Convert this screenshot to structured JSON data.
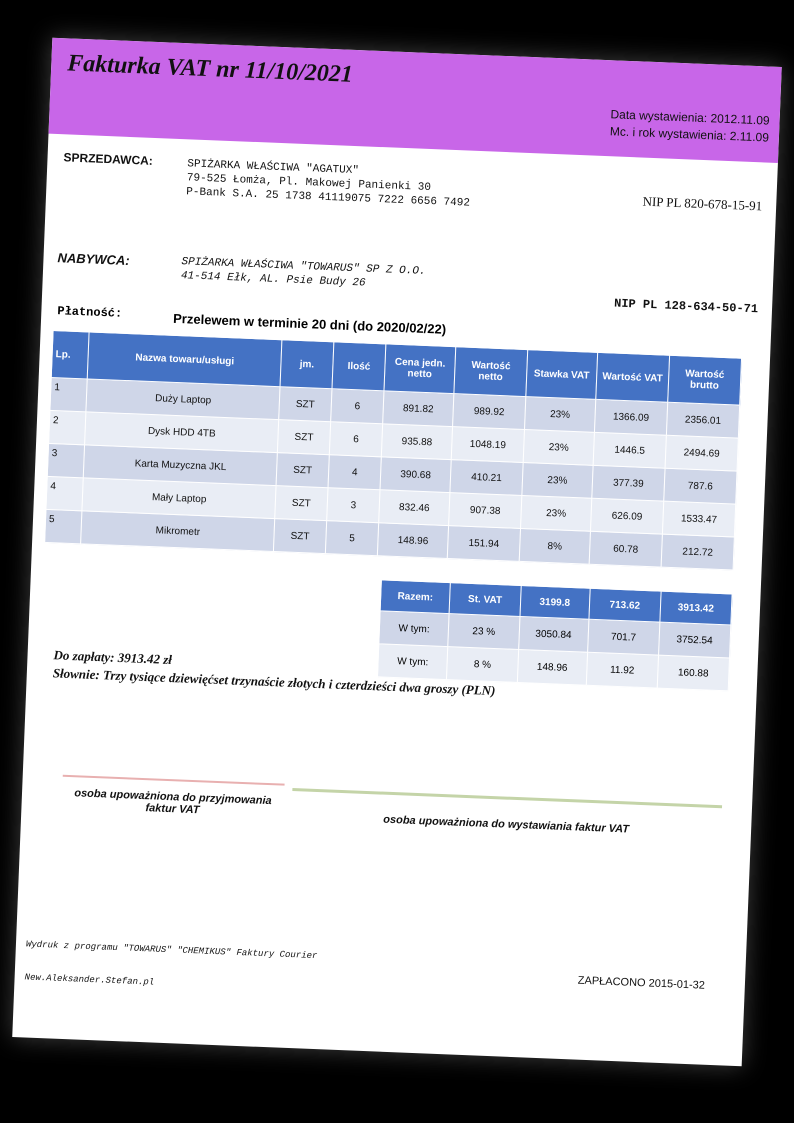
{
  "invoice": {
    "title": "Fakturka VAT nr 11/10/2021",
    "issue_date": "Data wystawienia: 2012.11.09",
    "issue_month": "Mc. i rok wystawienia: 2.11.09"
  },
  "seller": {
    "label": "SPRZEDAWCA:",
    "name": "SPIŻARKA WŁAŚCIWA \"AGATUX\"",
    "address": "79-525 Łomża, Pl. Makowej Panienki 30",
    "bank": "P-Bank S.A. 25 1738 41119075 7222 6656 7492",
    "nip": "NIP PL 820-678-15-91"
  },
  "buyer": {
    "label": "NABYWCA:",
    "name": "SPIŻARKA WŁAŚCIWA \"TOWARUS\" SP Z O.O.",
    "address": "41-514 Ełk, AL. Psie Budy 26",
    "nip": "NIP  PL  128-634-50-71"
  },
  "payment": {
    "label": "Płatność:",
    "text": "Przelewem w terminie 20 dni (do 2020/02/22)"
  },
  "table": {
    "headers": [
      "Lp.",
      "Nazwa towaru/usługi",
      "jm.",
      "Ilość",
      "Cena jedn. netto",
      "Wartość netto",
      "Stawka VAT",
      "Wartość VAT",
      "Wartość brutto"
    ],
    "rows": [
      [
        "1",
        "Duży Laptop",
        "SZT",
        "6",
        "891.82",
        "989.92",
        "23%",
        "1366.09",
        "2356.01"
      ],
      [
        "2",
        "Dysk HDD 4TB",
        "SZT",
        "6",
        "935.88",
        "1048.19",
        "23%",
        "1446.5",
        "2494.69"
      ],
      [
        "3",
        "Karta Muzyczna JKL",
        "SZT",
        "4",
        "390.68",
        "410.21",
        "23%",
        "377.39",
        "787.6"
      ],
      [
        "4",
        "Mały Laptop",
        "SZT",
        "3",
        "832.46",
        "907.38",
        "23%",
        "626.09",
        "1533.47"
      ],
      [
        "5",
        "Mikrometr",
        "SZT",
        "5",
        "148.96",
        "151.94",
        "8%",
        "60.78",
        "212.72"
      ]
    ]
  },
  "summary": {
    "head": [
      "Razem:",
      "St. VAT",
      "3199.8",
      "713.62",
      "3913.42"
    ],
    "rows": [
      [
        "W tym:",
        "23 %",
        "3050.84",
        "701.7",
        "3752.54"
      ],
      [
        "W tym:",
        "8 %",
        "148.96",
        "11.92",
        "160.88"
      ]
    ]
  },
  "totals": {
    "to_pay": "Do zapłaty: 3913.42 zł",
    "in_words": "Słownie: Trzy tysiące dziewięćset trzynaście złotych i czterdzieści  dwa groszy  (PLN)"
  },
  "signatures": {
    "receiver": "osoba upoważniona do przyjmowania faktur VAT",
    "issuer": "osoba upoważniona  do wystawiania  faktur VAT"
  },
  "footer": {
    "program_line1": "Wydruk z programu \"TOWARUS\" \"CHEMIKUS\" Faktury Courier",
    "program_line2": "New.Aleksander.Stefan.pl",
    "paid": "ZAPŁACONO  2015-01-32"
  }
}
